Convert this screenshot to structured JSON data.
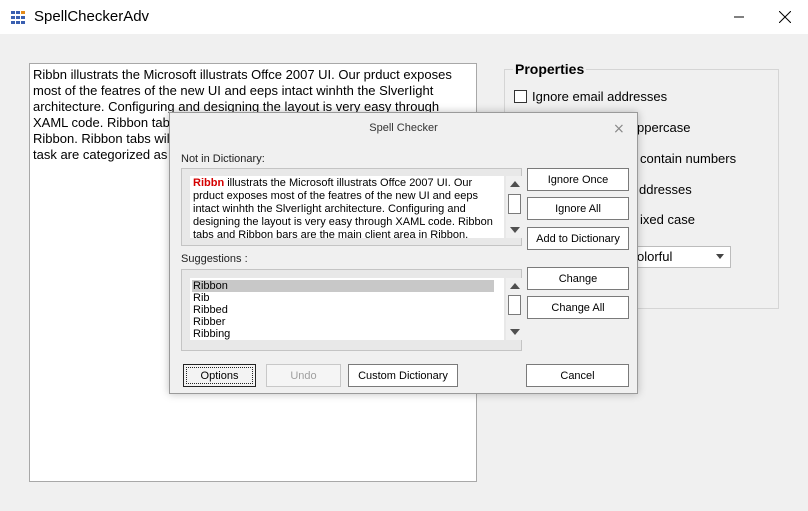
{
  "window": {
    "title": "SpellCheckerAdv"
  },
  "main_text": "Ribbn illustrats the Microsoft illustrats Offce 2007 UI. Our prduct exposes most of the featres of the new UI and eeps intact winhth the SlverIight architecture. Configuring and designing the layout is very easy through XAML code. Ribbon tabs and Ribbon bars are the main client area in Ribbon. Ribbon tabs will be wrapped, and appropriate tools for the specific task are categorized as Ribbon tools.",
  "properties": {
    "title": "Properties",
    "ignore_email": "Ignore email addresses",
    "ignore_uppercase": "ppercase",
    "ignore_numbers": "contain numbers",
    "ignore_internet": "ddresses",
    "ignore_mixed": "ixed case",
    "visual_style": "olorful"
  },
  "dialog": {
    "title": "Spell Checker",
    "close": "×",
    "not_in_dictionary_label": "Not in Dictionary:",
    "error_word": "Ribbn",
    "context_rest": " illustrats the Microsoft illustrats Offce 2007 UI. Our prduct exposes most of the featres of the new UI and eeps intact winhth the SlverIight architecture. Configuring and designing the layout is very easy through XAML code. Ribbon tabs and Ribbon bars are the main client area in Ribbon. Ribbon",
    "suggestions_label": "Suggestions :",
    "suggestions": [
      "Ribbon",
      "Rib",
      "Ribbed",
      "Ribber",
      "Ribbing"
    ],
    "buttons": {
      "ignore_once": "Ignore Once",
      "ignore_all": "Ignore All",
      "add_to_dictionary": "Add to Dictionary",
      "change": "Change",
      "change_all": "Change All",
      "options": "Options",
      "undo": "Undo",
      "custom_dictionary": "Custom Dictionary",
      "cancel": "Cancel"
    }
  }
}
